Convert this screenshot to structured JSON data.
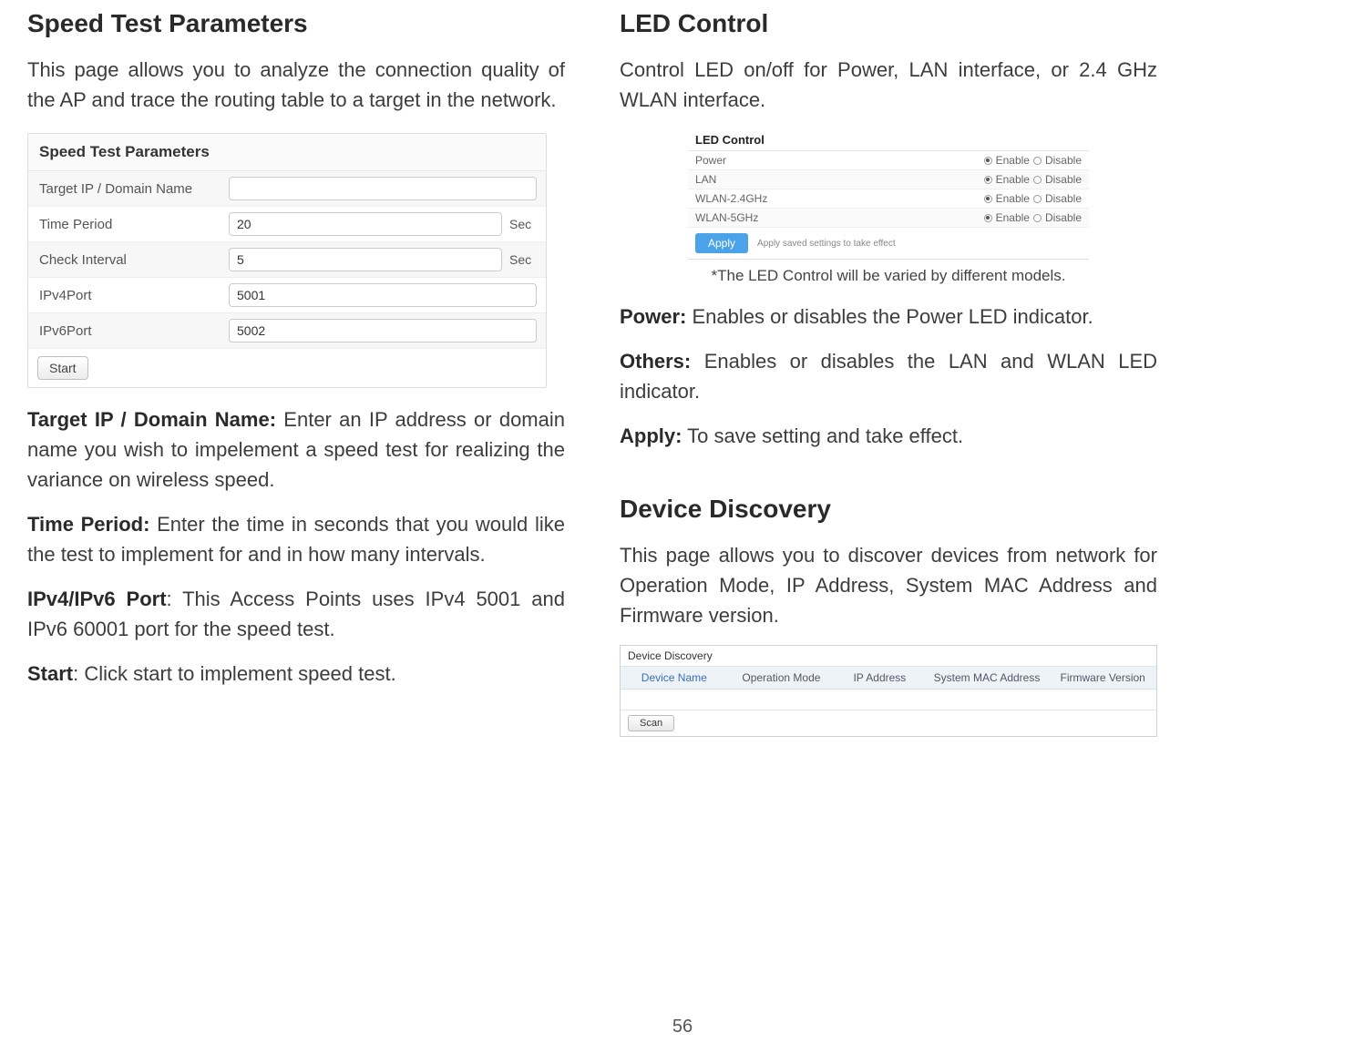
{
  "left": {
    "heading": "Speed Test Parameters",
    "intro": "This page allows you to analyze the connection quality of the AP and trace the routing table to a target in the network.",
    "speedtest": {
      "title": "Speed Test Parameters",
      "rows": [
        {
          "label": "Target IP / Domain Name",
          "value": "",
          "unit": ""
        },
        {
          "label": "Time Period",
          "value": "20",
          "unit": "Sec"
        },
        {
          "label": "Check Interval",
          "value": "5",
          "unit": "Sec"
        },
        {
          "label": "IPv4Port",
          "value": "5001",
          "unit": ""
        },
        {
          "label": "IPv6Port",
          "value": "5002",
          "unit": ""
        }
      ],
      "start_label": "Start"
    },
    "para_target_label": "Target IP / Domain Name:",
    "para_target_text": " Enter an IP address or domain name you wish to impelement a speed test for realizing the variance on wireless speed.",
    "para_time_label": "Time Period:",
    "para_time_text": " Enter the time in seconds that you would like the test to implement for and in how many intervals.",
    "para_port_label": "IPv4/IPv6 Port",
    "para_port_text": ": This Access Points uses IPv4 5001 and IPv6 60001 port for the speed test.",
    "para_start_label": "Start",
    "para_start_text": ": Click start to implement speed test."
  },
  "right": {
    "heading_led": "LED Control",
    "intro_led": "Control LED on/off for Power, LAN interface, or 2.4 GHz WLAN interface.",
    "ledbox": {
      "title": "LED Control",
      "rows": [
        {
          "name": "Power"
        },
        {
          "name": "LAN"
        },
        {
          "name": "WLAN-2.4GHz"
        },
        {
          "name": "WLAN-5GHz"
        }
      ],
      "enable_label": "Enable",
      "disable_label": "Disable",
      "apply_label": "Apply",
      "apply_hint": "Apply saved settings to take effect"
    },
    "note": "*The LED Control will be varied by different models.",
    "para_power_label": "Power:",
    "para_power_text": " Enables or disables the Power LED indicator.",
    "para_others_label": "Others:",
    "para_others_text": " Enables or disables the LAN and WLAN LED indicator.",
    "para_apply_label": "Apply:",
    "para_apply_text": " To save setting and take effect.",
    "heading_dd": "Device Discovery",
    "intro_dd": "This page allows you to discover devices from network for Operation Mode, IP Address, System MAC Address and Firmware version.",
    "ddbox": {
      "title": "Device Discovery",
      "headers": [
        "Device Name",
        "Operation Mode",
        "IP Address",
        "System MAC Address",
        "Firmware Version"
      ],
      "scan_label": "Scan"
    }
  },
  "page_number": "56"
}
